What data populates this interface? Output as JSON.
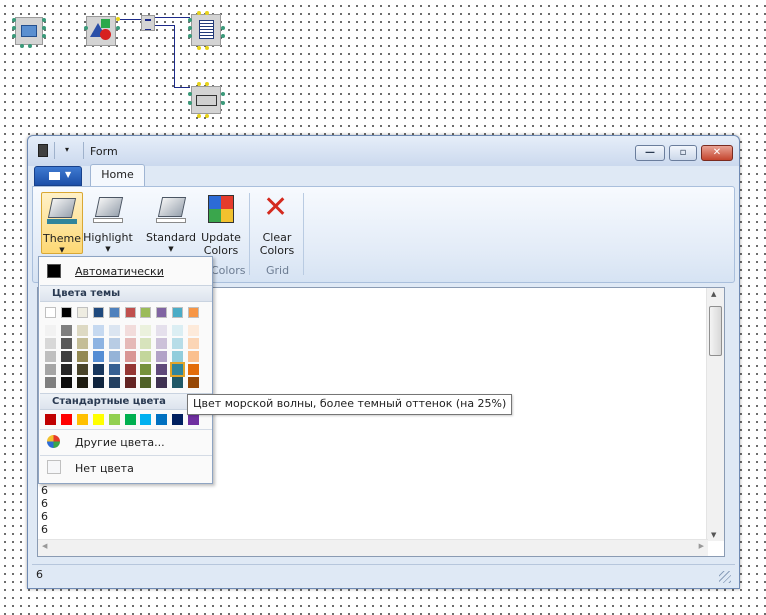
{
  "window": {
    "title": "Form",
    "tab_home": "Home"
  },
  "ribbon": {
    "buttons": {
      "theme": "Theme",
      "highlight": "Highlight",
      "standard": "Standard",
      "update_colors": "Update Colors",
      "clear_colors": "Clear Colors"
    },
    "groups": {
      "colors": "Colors",
      "grid": "Grid"
    }
  },
  "editor": {
    "lines": [
      "6",
      "6",
      "6",
      "6"
    ]
  },
  "status": {
    "text": "6"
  },
  "dropdown": {
    "automatic": "Автоматически",
    "theme_colors_header": "Цвета темы",
    "standard_colors_header": "Стандартные цвета",
    "more_colors": "Другие цвета...",
    "no_color": "Нет цвета",
    "theme_top_row": [
      "#ffffff",
      "#000000",
      "#eeece1",
      "#1f497d",
      "#4f81bd",
      "#c0504d",
      "#9bbb59",
      "#8064a2",
      "#4bacc6",
      "#f79646"
    ],
    "theme_shades": [
      [
        "#f2f2f2",
        "#7f7f7f",
        "#ddd9c3",
        "#c6d9f0",
        "#dbe5f1",
        "#f2dcdb",
        "#ebf1dd",
        "#e5e0ec",
        "#dbeef3",
        "#fdeada"
      ],
      [
        "#d8d8d8",
        "#595959",
        "#c4bd97",
        "#8db3e2",
        "#b8cce4",
        "#e5b9b7",
        "#d7e3bc",
        "#ccc1d9",
        "#b7dde8",
        "#fbd5b5"
      ],
      [
        "#bfbfbf",
        "#3f3f3f",
        "#938953",
        "#548dd4",
        "#95b3d7",
        "#d99694",
        "#c3d69b",
        "#b2a2c7",
        "#92cddc",
        "#fac08f"
      ],
      [
        "#a5a5a5",
        "#262626",
        "#494429",
        "#17365d",
        "#366092",
        "#953734",
        "#76923c",
        "#5f497a",
        "#31859b",
        "#e36c09"
      ],
      [
        "#7f7f7f",
        "#0c0c0c",
        "#1d1b10",
        "#0f243e",
        "#244061",
        "#632423",
        "#4f6128",
        "#3f3151",
        "#205867",
        "#974806"
      ]
    ],
    "standard_colors": [
      "#c00000",
      "#ff0000",
      "#ffc000",
      "#ffff00",
      "#92d050",
      "#00b050",
      "#00b0f0",
      "#0070c0",
      "#002060",
      "#7030a0"
    ],
    "tooltip": "Цвет морской волны, более темный оттенок (на 25%)"
  },
  "colors": {
    "titlebar": "#cbd9ee",
    "ribbon": "#e2ebf7",
    "selected_button": "#fed874",
    "wire": "#1c2a8a"
  }
}
